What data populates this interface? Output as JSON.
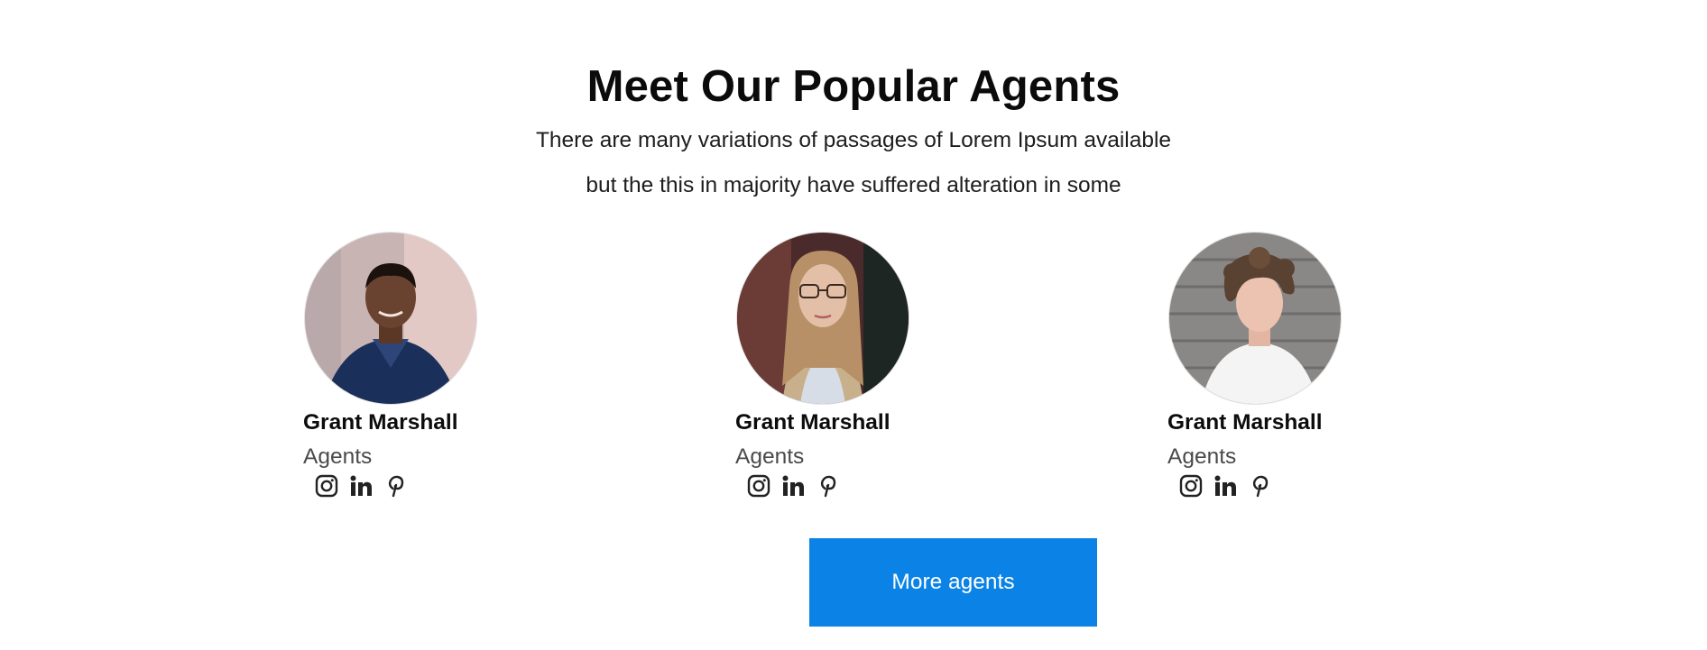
{
  "section": {
    "title": "Meet Our Popular Agents",
    "subtitle_line1": "There are many variations of passages of Lorem Ipsum available",
    "subtitle_line2": "but the this in majority have suffered alteration in some"
  },
  "agents": [
    {
      "name": "Grant Marshall",
      "role": "Agents",
      "socials": [
        "instagram-icon",
        "linkedin-icon",
        "pinterest-icon"
      ]
    },
    {
      "name": "Grant Marshall",
      "role": "Agents",
      "socials": [
        "instagram-icon",
        "linkedin-icon",
        "pinterest-icon"
      ]
    },
    {
      "name": "Grant Marshall",
      "role": "Agents",
      "socials": [
        "instagram-icon",
        "linkedin-icon",
        "pinterest-icon"
      ]
    }
  ],
  "cta": {
    "label": "More agents"
  },
  "colors": {
    "button_bg": "#0b83e6",
    "button_text": "#ffffff",
    "heading": "#0b0b0b",
    "role_text": "#4a4a4a"
  }
}
